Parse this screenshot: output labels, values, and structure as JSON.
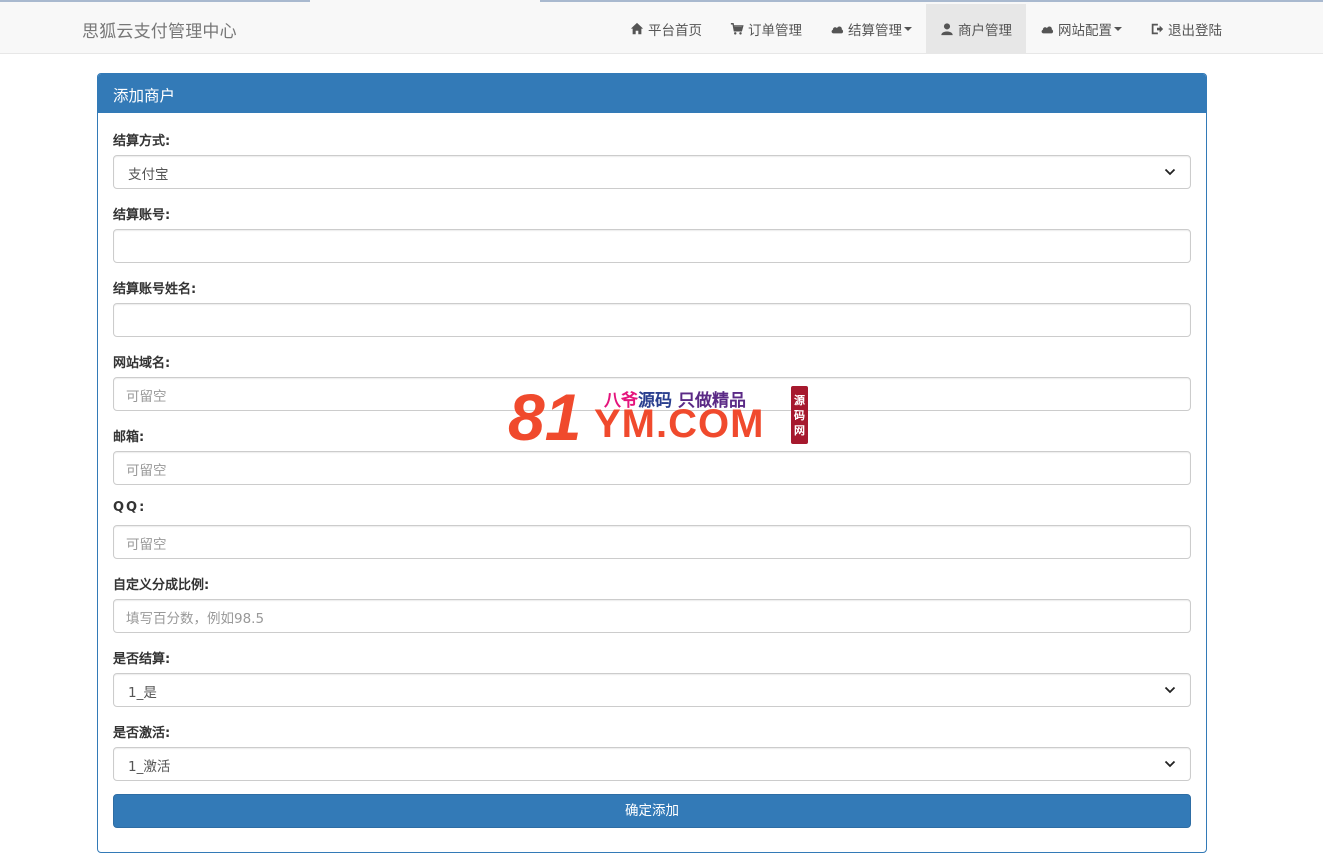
{
  "brand": "思狐云支付管理中心",
  "nav": [
    {
      "label": "平台首页",
      "icon": "home-icon"
    },
    {
      "label": "订单管理",
      "icon": "cart-icon"
    },
    {
      "label": "结算管理",
      "icon": "cloud-icon",
      "dropdown": true
    },
    {
      "label": "商户管理",
      "icon": "user-icon",
      "active": true
    },
    {
      "label": "网站配置",
      "icon": "cloud-icon",
      "dropdown": true
    },
    {
      "label": "退出登陆",
      "icon": "logout-icon"
    }
  ],
  "panel": {
    "title": "添加商户"
  },
  "form": {
    "settle_type": {
      "label": "结算方式:",
      "value": "支付宝"
    },
    "account": {
      "label": "结算账号:",
      "value": ""
    },
    "account_name": {
      "label": "结算账号姓名:",
      "value": ""
    },
    "domain": {
      "label": "网站域名:",
      "placeholder": "可留空"
    },
    "email": {
      "label": "邮箱:",
      "placeholder": "可留空"
    },
    "qq": {
      "label": "QQ:",
      "placeholder": "可留空"
    },
    "ratio": {
      "label": "自定义分成比例:",
      "placeholder": "填写百分数，例如98.5"
    },
    "settle": {
      "label": "是否结算:",
      "value": "1_是"
    },
    "active": {
      "label": "是否激活:",
      "value": "1_激活"
    },
    "submit_label": "确定添加"
  },
  "watermark": {
    "big": "81",
    "small": "YM.COM",
    "tag1": "八爷",
    "tag2": "源码",
    "tag3": "只做精品",
    "seal": [
      "源",
      "码",
      "网"
    ]
  },
  "colors": {
    "primary": "#337ab7",
    "watermark": "#f04a2d",
    "seal": "#a6192e"
  }
}
